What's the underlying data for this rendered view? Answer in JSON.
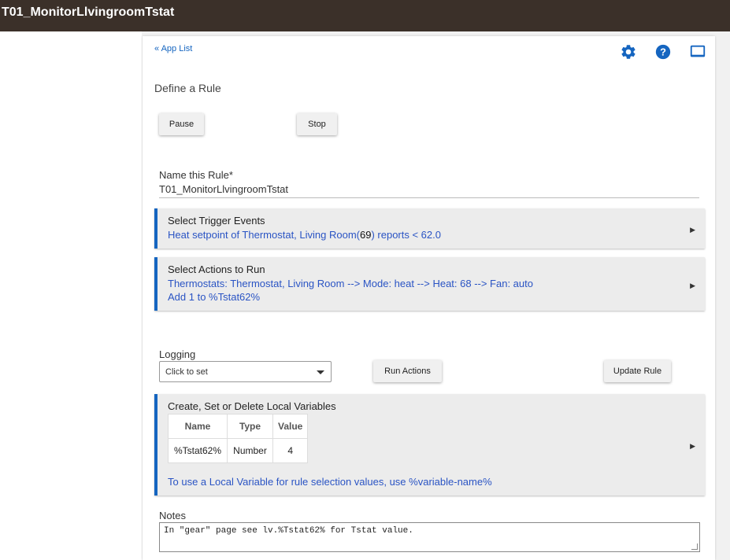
{
  "header": {
    "title": "T01_MonitorLlvingroomTstat"
  },
  "nav": {
    "app_list": "« App List"
  },
  "icons": {
    "settings": "gear-icon",
    "help": "help-icon",
    "display": "monitor-icon",
    "accent": "#1565c0"
  },
  "page": {
    "heading": "Define a Rule"
  },
  "controls": {
    "pause_label": "Pause",
    "stop_label": "Stop"
  },
  "rule_name": {
    "label": "Name this Rule*",
    "value": "T01_MonitorLlvingroomTstat"
  },
  "triggers": {
    "heading": "Select Trigger Events",
    "desc_pre": "Heat setpoint of Thermostat, Living Room(",
    "desc_value": "69",
    "desc_post": ") reports < 62.0"
  },
  "actions": {
    "heading": "Select Actions to Run",
    "line1": "Thermostats: Thermostat, Living Room --> Mode: heat --> Heat: 68 --> Fan: auto",
    "line2": "Add 1 to %Tstat62%"
  },
  "logging": {
    "label": "Logging",
    "select_value": "Click to set"
  },
  "buttons": {
    "run_actions": "Run Actions",
    "update_rule": "Update Rule"
  },
  "local_vars": {
    "heading": "Create, Set or Delete Local Variables",
    "columns": [
      "Name",
      "Type",
      "Value"
    ],
    "rows": [
      {
        "name": "%Tstat62%",
        "type": "Number",
        "value": "4"
      }
    ],
    "hint": "To use a Local Variable for rule selection values, use %variable-name%"
  },
  "notes": {
    "label": "Notes",
    "value": "In \"gear\" page see lv.%Tstat62% for Tstat value."
  }
}
